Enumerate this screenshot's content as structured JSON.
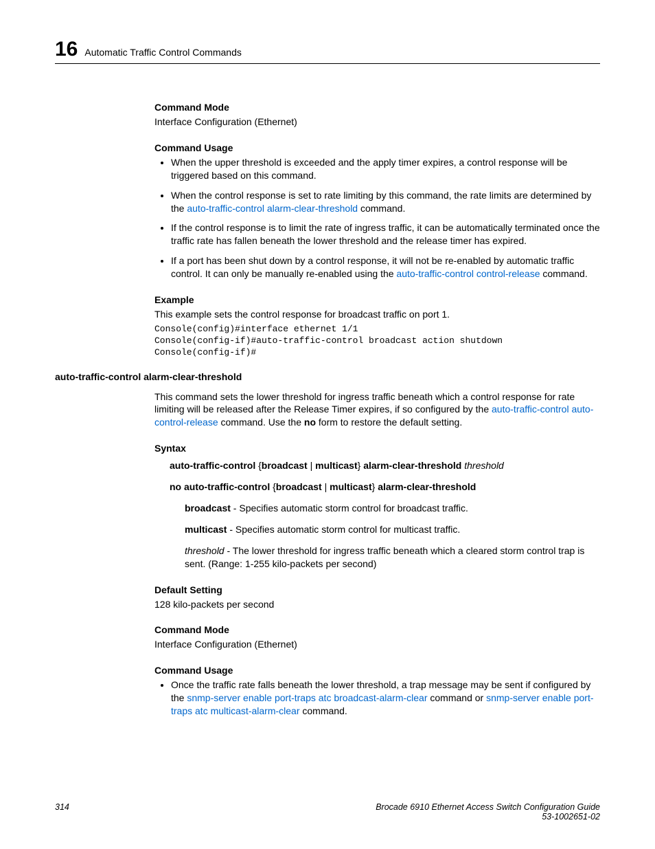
{
  "header": {
    "chapter_number": "16",
    "chapter_title": "Automatic Traffic Control Commands"
  },
  "s1": {
    "command_mode_h": "Command Mode",
    "command_mode_t": "Interface Configuration (Ethernet)",
    "command_usage_h": "Command Usage",
    "bullets": {
      "b1": "When the upper threshold is exceeded and the apply timer expires, a control response will be triggered based on this command.",
      "b2a": "When the control response is set to rate limiting by this command, the rate limits are determined by the ",
      "b2link": "auto-traffic-control alarm-clear-threshold",
      "b2b": " command.",
      "b3": "If the control response is to limit the rate of ingress traffic, it can be automatically terminated once the traffic rate has fallen beneath the lower threshold and the release timer has expired.",
      "b4a": "If a port has been shut down by a control response, it will not be re-enabled by automatic traffic control. It can only be manually re-enabled using the ",
      "b4link": "auto-traffic-control control-release",
      "b4b": " command."
    },
    "example_h": "Example",
    "example_t": "This example sets the control response for broadcast traffic on port 1.",
    "code": "Console(config)#interface ethernet 1/1\nConsole(config-if)#auto-traffic-control broadcast action shutdown\nConsole(config-if)#"
  },
  "s2": {
    "title": "auto-traffic-control alarm-clear-threshold",
    "intro_a": "This command sets the lower threshold for ingress traffic beneath which a control response for rate limiting will be released after the Release Timer expires, if so configured by the ",
    "intro_link": "auto-traffic-control auto-control-release",
    "intro_b": " command. Use the ",
    "intro_no": "no",
    "intro_c": " form to restore the default setting.",
    "syntax_h": "Syntax",
    "syntax_line1_b1": "auto-traffic-control",
    "syntax_line1_p1": " {",
    "syntax_line1_b2": "broadcast",
    "syntax_line1_p2": " | ",
    "syntax_line1_b3": "multicast",
    "syntax_line1_p3": "} ",
    "syntax_line1_b4": "alarm-clear-threshold",
    "syntax_line1_i": " threshold",
    "syntax_line2_b1": "no auto-traffic-control",
    "syntax_line2_p1": " {",
    "syntax_line2_b2": "broadcast",
    "syntax_line2_p2": " | ",
    "syntax_line2_b3": "multicast",
    "syntax_line2_p3": "} ",
    "syntax_line2_b4": "alarm-clear-threshold",
    "param_bcast_b": "broadcast",
    "param_bcast_t": " - Specifies automatic storm control for broadcast traffic.",
    "param_mcast_b": "multicast",
    "param_mcast_t": " - Specifies automatic storm control for multicast traffic.",
    "param_thresh_i": "threshold",
    "param_thresh_t": " - The lower threshold for ingress traffic beneath which a cleared storm control trap is sent. (Range: 1-255 kilo-packets per second)",
    "default_h": "Default Setting",
    "default_t": "128 kilo-packets per second",
    "cmdmode_h": "Command Mode",
    "cmdmode_t": "Interface Configuration (Ethernet)",
    "cmdusage_h": "Command Usage",
    "usage_a": "Once the traffic rate falls beneath the lower threshold, a trap message may be sent if configured by the ",
    "usage_link1": "snmp-server enable port-traps atc broadcast-alarm-clear",
    "usage_b": " command or ",
    "usage_link2": "snmp-server enable port-traps atc multicast-alarm-clear",
    "usage_c": " command."
  },
  "footer": {
    "page": "314",
    "book": "Brocade 6910 Ethernet Access Switch Configuration Guide",
    "docnum": "53-1002651-02"
  }
}
